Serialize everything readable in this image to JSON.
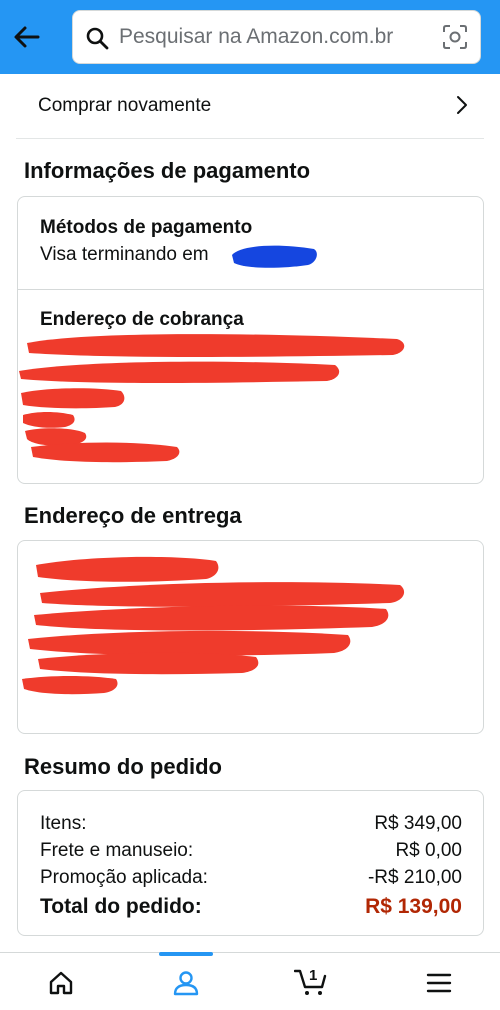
{
  "header": {
    "search_placeholder": "Pesquisar na Amazon.com.br"
  },
  "buy_again": {
    "label": "Comprar novamente"
  },
  "payment": {
    "section_title": "Informações de pagamento",
    "methods_title": "Métodos de pagamento",
    "methods_value": "Visa terminando em",
    "billing_title": "Endereço de cobrança"
  },
  "shipping": {
    "section_title": "Endereço de entrega"
  },
  "summary": {
    "section_title": "Resumo do pedido",
    "rows": [
      {
        "label": "Itens:",
        "value": "R$ 349,00"
      },
      {
        "label": "Frete e manuseio:",
        "value": "R$ 0,00"
      },
      {
        "label": "Promoção aplicada:",
        "value": "-R$ 210,00"
      }
    ],
    "total": {
      "label": "Total do pedido:",
      "value": "R$ 139,00"
    }
  },
  "bottom_nav": {
    "items": [
      "home-icon",
      "account-icon",
      "cart-icon",
      "menu-icon"
    ],
    "active": "account-icon",
    "cart_count": "1"
  },
  "colors": {
    "header_blue": "#2596f3",
    "total_red": "#b12704",
    "redaction_red": "#ef3b2c",
    "redaction_blue": "#1546e0"
  }
}
